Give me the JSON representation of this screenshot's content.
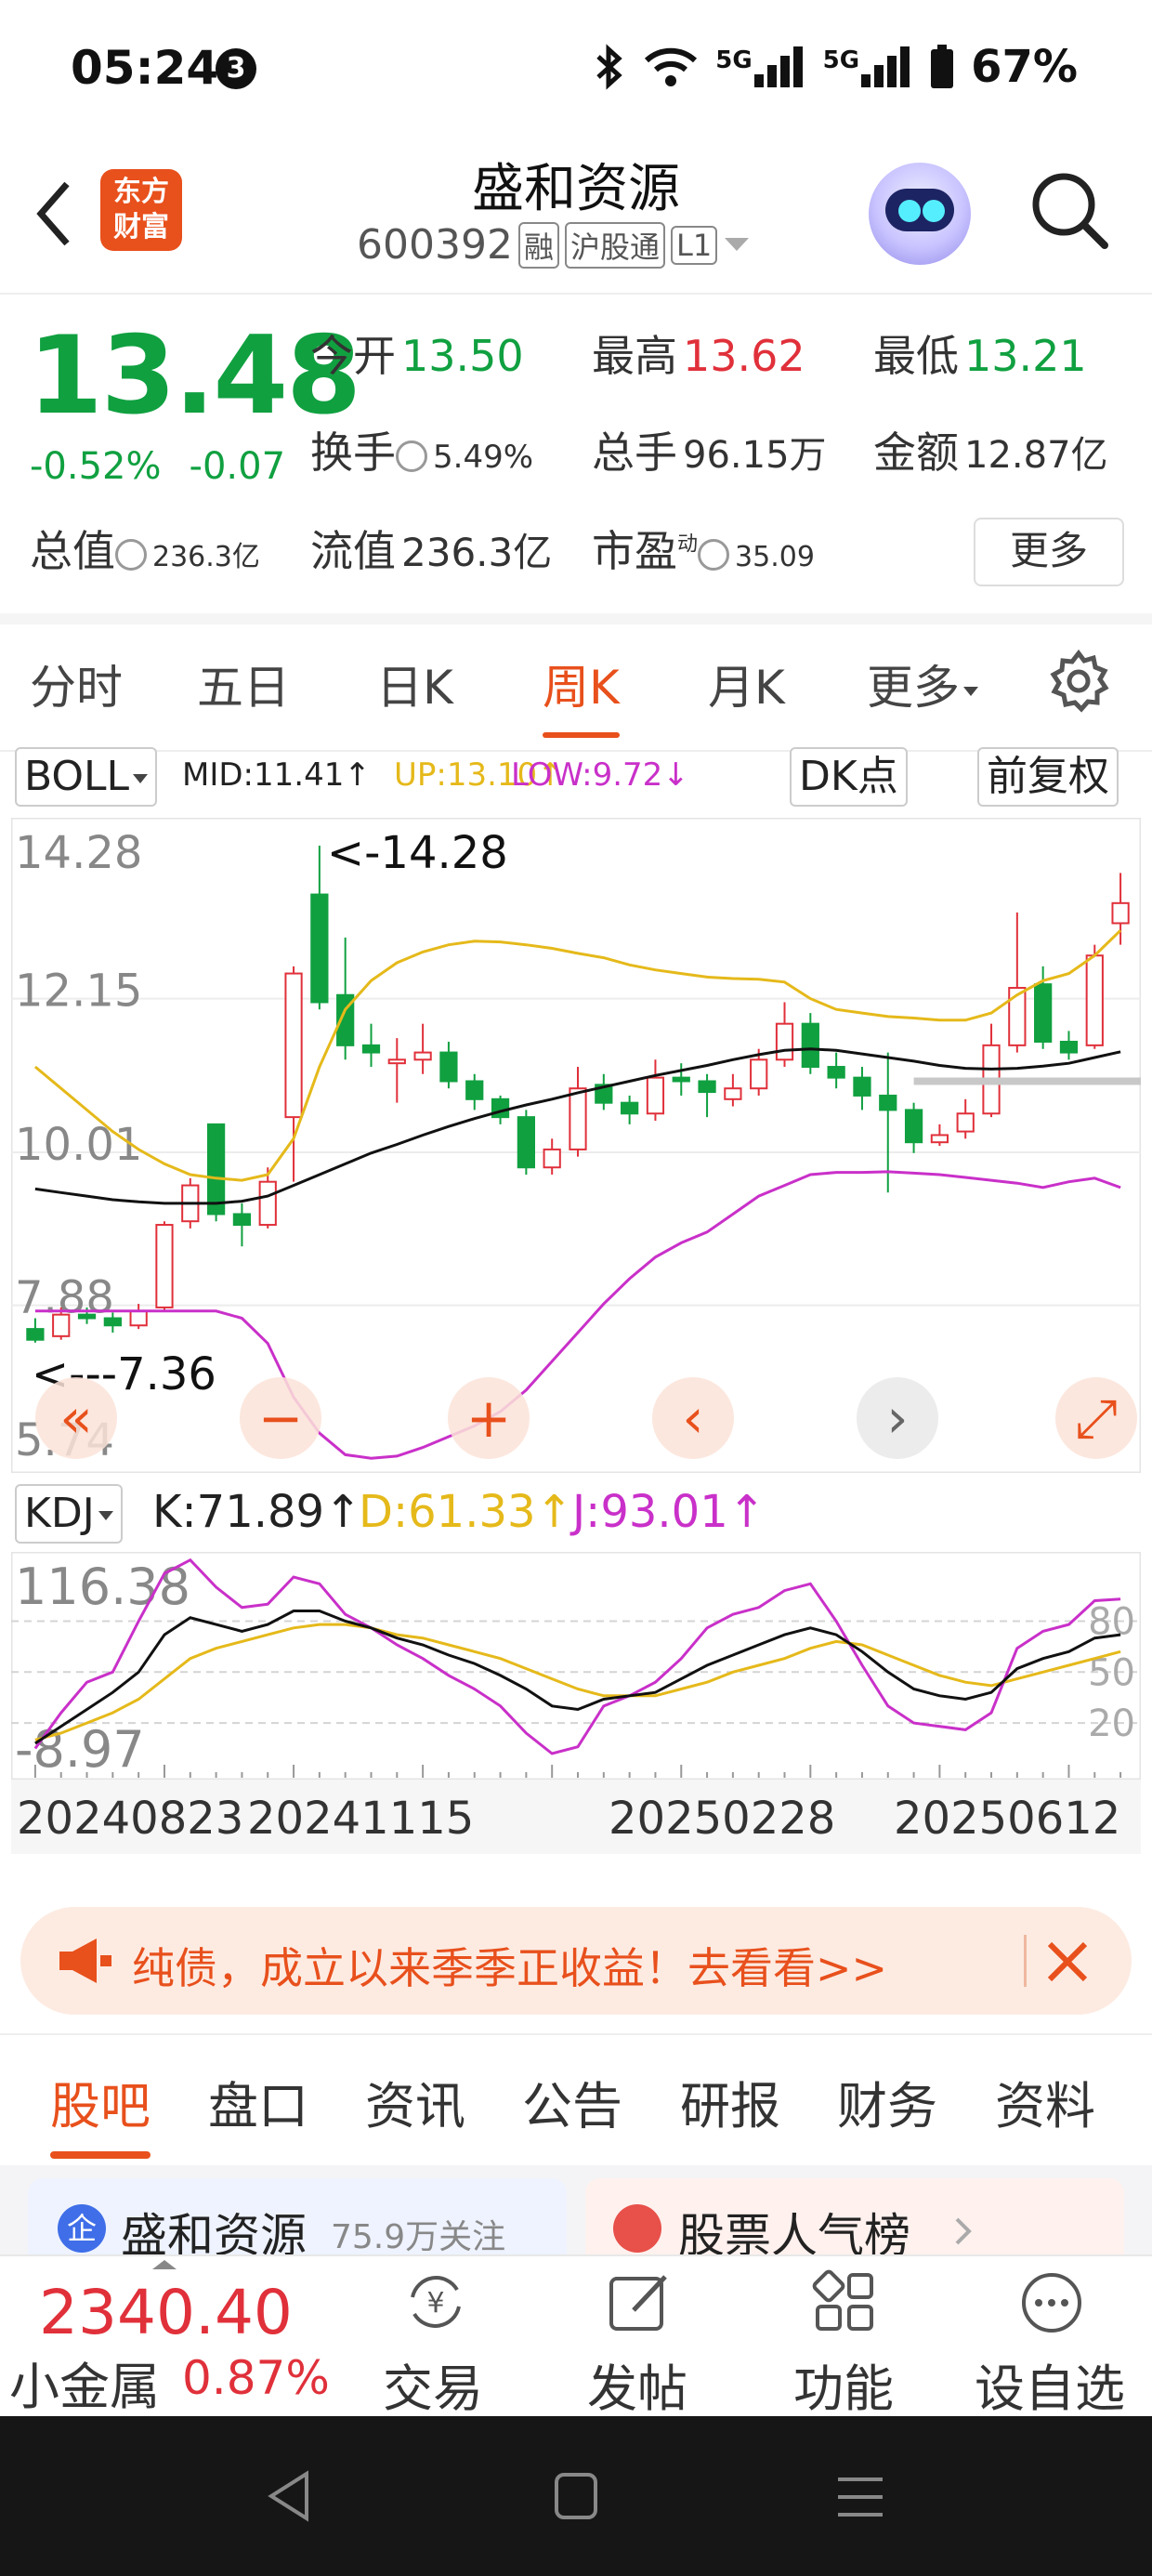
{
  "status_bar": {
    "time": "05:24",
    "badge": "3",
    "network": "5G",
    "network2": "5G",
    "battery": "67%"
  },
  "header": {
    "title": "盛和资源",
    "code": "600392",
    "tags": [
      "融",
      "沪股通",
      "L1"
    ],
    "logo_text": "东方财富"
  },
  "quote": {
    "price": "13.48",
    "change_pct": "-0.52%",
    "change": "-0.07",
    "open_label": "今开",
    "open": "13.50",
    "high_label": "最高",
    "high": "13.62",
    "low_label": "最低",
    "low": "13.21",
    "turnover_label": "换手",
    "turnover": "5.49%",
    "volume_label": "总手",
    "volume": "96.15万",
    "amount_label": "金额",
    "amount": "12.87亿",
    "mktcap_label": "总值",
    "mktcap": "236.3亿",
    "float_label": "流值",
    "float": "236.3亿",
    "pe_label": "市盈",
    "pe_sup": "动",
    "pe": "35.09",
    "more": "更多"
  },
  "tabs": [
    {
      "label": "分时"
    },
    {
      "label": "五日"
    },
    {
      "label": "日K"
    },
    {
      "label": "周K"
    },
    {
      "label": "月K"
    },
    {
      "label": "更多"
    }
  ],
  "active_tab": "周K",
  "indicator": {
    "name": "BOLL",
    "mid": "MID:11.41↑",
    "up": "UP:13.10↑",
    "low": "LOW:9.72↓",
    "dk": "DK点",
    "fq": "前复权"
  },
  "chart_data": {
    "type": "candlestick",
    "y_ticks": [
      "14.28",
      "12.15",
      "10.01",
      "7.88",
      "5.74"
    ],
    "ylim": [
      5.74,
      14.28
    ],
    "max_label": "<-14.28",
    "min_label": "<---7.36",
    "candles": [
      {
        "o": 7.55,
        "c": 7.4,
        "h": 7.7,
        "l": 7.36
      },
      {
        "o": 7.45,
        "c": 7.75,
        "h": 7.85,
        "l": 7.4
      },
      {
        "o": 7.75,
        "c": 7.7,
        "h": 7.85,
        "l": 7.62
      },
      {
        "o": 7.7,
        "c": 7.6,
        "h": 7.78,
        "l": 7.5
      },
      {
        "o": 7.6,
        "c": 7.8,
        "h": 7.9,
        "l": 7.55
      },
      {
        "o": 7.85,
        "c": 9.0,
        "h": 9.05,
        "l": 7.8
      },
      {
        "o": 9.05,
        "c": 9.55,
        "h": 9.65,
        "l": 8.95
      },
      {
        "o": 10.4,
        "c": 9.15,
        "h": 10.4,
        "l": 9.05
      },
      {
        "o": 9.15,
        "c": 9.0,
        "h": 9.3,
        "l": 8.7
      },
      {
        "o": 9.0,
        "c": 9.6,
        "h": 9.8,
        "l": 8.95
      },
      {
        "o": 10.5,
        "c": 12.5,
        "h": 12.6,
        "l": 9.6
      },
      {
        "o": 13.6,
        "c": 12.1,
        "h": 14.28,
        "l": 12.0
      },
      {
        "o": 12.2,
        "c": 11.5,
        "h": 13.0,
        "l": 11.3
      },
      {
        "o": 11.5,
        "c": 11.4,
        "h": 11.8,
        "l": 11.2
      },
      {
        "o": 11.25,
        "c": 11.3,
        "h": 11.6,
        "l": 10.7
      },
      {
        "o": 11.3,
        "c": 11.4,
        "h": 11.8,
        "l": 11.1
      },
      {
        "o": 11.4,
        "c": 11.0,
        "h": 11.55,
        "l": 10.9
      },
      {
        "o": 11.0,
        "c": 10.75,
        "h": 11.1,
        "l": 10.6
      },
      {
        "o": 10.75,
        "c": 10.5,
        "h": 10.8,
        "l": 10.4
      },
      {
        "o": 10.5,
        "c": 9.8,
        "h": 10.6,
        "l": 9.7
      },
      {
        "o": 9.8,
        "c": 10.05,
        "h": 10.2,
        "l": 9.7
      },
      {
        "o": 10.05,
        "c": 10.9,
        "h": 11.2,
        "l": 9.95
      },
      {
        "o": 10.95,
        "c": 10.7,
        "h": 11.1,
        "l": 10.6
      },
      {
        "o": 10.7,
        "c": 10.55,
        "h": 10.8,
        "l": 10.4
      },
      {
        "o": 10.55,
        "c": 11.05,
        "h": 11.3,
        "l": 10.45
      },
      {
        "o": 11.05,
        "c": 11.0,
        "h": 11.25,
        "l": 10.8
      },
      {
        "o": 11.0,
        "c": 10.85,
        "h": 11.1,
        "l": 10.5
      },
      {
        "o": 10.75,
        "c": 10.9,
        "h": 11.1,
        "l": 10.65
      },
      {
        "o": 10.9,
        "c": 11.3,
        "h": 11.45,
        "l": 10.8
      },
      {
        "o": 11.3,
        "c": 11.8,
        "h": 12.1,
        "l": 11.2
      },
      {
        "o": 11.8,
        "c": 11.2,
        "h": 11.95,
        "l": 11.1
      },
      {
        "o": 11.2,
        "c": 11.05,
        "h": 11.4,
        "l": 10.9
      },
      {
        "o": 11.05,
        "c": 10.8,
        "h": 11.2,
        "l": 10.6
      },
      {
        "o": 10.8,
        "c": 10.6,
        "h": 11.4,
        "l": 9.45
      },
      {
        "o": 10.6,
        "c": 10.15,
        "h": 10.7,
        "l": 10.0
      },
      {
        "o": 10.15,
        "c": 10.25,
        "h": 10.4,
        "l": 10.1
      },
      {
        "o": 10.3,
        "c": 10.55,
        "h": 10.75,
        "l": 10.2
      },
      {
        "o": 10.55,
        "c": 11.5,
        "h": 11.8,
        "l": 10.5
      },
      {
        "o": 11.5,
        "c": 12.3,
        "h": 13.35,
        "l": 11.4
      },
      {
        "o": 12.35,
        "c": 11.55,
        "h": 12.6,
        "l": 11.45
      },
      {
        "o": 11.55,
        "c": 11.4,
        "h": 11.7,
        "l": 11.3
      },
      {
        "o": 11.5,
        "c": 12.75,
        "h": 12.9,
        "l": 11.45
      },
      {
        "o": 13.2,
        "c": 13.48,
        "h": 13.9,
        "l": 12.9
      }
    ],
    "boll_mid": [
      9.5,
      9.45,
      9.4,
      9.35,
      9.32,
      9.3,
      9.3,
      9.3,
      9.33,
      9.4,
      9.55,
      9.7,
      9.85,
      10.0,
      10.12,
      10.25,
      10.37,
      10.48,
      10.58,
      10.67,
      10.75,
      10.84,
      10.92,
      11.0,
      11.08,
      11.15,
      11.22,
      11.3,
      11.37,
      11.43,
      11.45,
      11.43,
      11.38,
      11.33,
      11.28,
      11.22,
      11.18,
      11.17,
      11.18,
      11.21,
      11.25,
      11.33,
      11.41
    ],
    "boll_up": [
      11.2,
      10.9,
      10.6,
      10.3,
      10.05,
      9.85,
      9.7,
      9.65,
      9.62,
      9.7,
      10.2,
      11.2,
      12.0,
      12.4,
      12.65,
      12.8,
      12.9,
      12.95,
      12.94,
      12.9,
      12.85,
      12.78,
      12.72,
      12.62,
      12.55,
      12.5,
      12.45,
      12.43,
      12.42,
      12.38,
      12.15,
      12.0,
      11.95,
      11.9,
      11.88,
      11.85,
      11.85,
      11.95,
      12.2,
      12.4,
      12.5,
      12.75,
      13.1
    ],
    "boll_low": [
      7.8,
      7.8,
      7.8,
      7.8,
      7.8,
      7.8,
      7.8,
      7.8,
      7.7,
      7.35,
      6.6,
      6.1,
      5.8,
      5.75,
      5.78,
      5.9,
      6.05,
      6.2,
      6.4,
      6.7,
      7.1,
      7.5,
      7.9,
      8.25,
      8.55,
      8.75,
      8.9,
      9.15,
      9.4,
      9.55,
      9.7,
      9.73,
      9.73,
      9.74,
      9.72,
      9.7,
      9.66,
      9.62,
      9.58,
      9.52,
      9.6,
      9.65,
      9.52
    ]
  },
  "chart_controls": [
    "rewind-icon",
    "zoom-out-icon",
    "zoom-in-icon",
    "prev-icon",
    "next-icon",
    "fullscreen-icon"
  ],
  "kdj": {
    "name": "KDJ",
    "k": "K:71.89↑",
    "d": "D:61.33↑",
    "j": "J:93.01↑",
    "y_top": "116.38",
    "y_bottom": "-8.97",
    "levels": [
      "80",
      "50",
      "20"
    ],
    "ylim": [
      -8.97,
      116.38
    ],
    "K": [
      8,
      18,
      28,
      38,
      50,
      72,
      82,
      78,
      74,
      78,
      86,
      86,
      80,
      76,
      70,
      66,
      60,
      55,
      48,
      40,
      30,
      28,
      34,
      36,
      38,
      46,
      54,
      60,
      66,
      72,
      76,
      72,
      62,
      50,
      40,
      36,
      34,
      38,
      52,
      58,
      62,
      70,
      72
    ],
    "D": [
      10,
      14,
      20,
      26,
      34,
      46,
      58,
      64,
      68,
      72,
      76,
      78,
      78,
      76,
      72,
      70,
      66,
      62,
      58,
      52,
      46,
      40,
      36,
      36,
      36,
      40,
      44,
      50,
      54,
      58,
      64,
      68,
      66,
      60,
      54,
      48,
      44,
      42,
      46,
      50,
      54,
      58,
      62
    ],
    "J": [
      5,
      26,
      44,
      50,
      80,
      108,
      116,
      100,
      88,
      90,
      106,
      102,
      84,
      76,
      66,
      58,
      48,
      40,
      30,
      14,
      2,
      6,
      30,
      36,
      44,
      58,
      76,
      84,
      88,
      98,
      102,
      80,
      54,
      30,
      20,
      18,
      16,
      26,
      64,
      74,
      78,
      92,
      93
    ]
  },
  "dates": [
    "20240823",
    "20241115",
    "20250228",
    "20250612"
  ],
  "banner": {
    "text": "纯债，成立以来季季正收益！去看看>>"
  },
  "sub_tabs": [
    "股吧",
    "盘口",
    "资讯",
    "公告",
    "研报",
    "财务",
    "资料"
  ],
  "cards": {
    "left_title": "盛和资源",
    "left_sub": "75.9万关注",
    "right_title": "股票人气榜"
  },
  "bottom_bar": {
    "index_value": "2340.40",
    "index_name": "小金属",
    "index_change": "0.87%",
    "items": [
      "交易",
      "发帖",
      "功能",
      "设自选"
    ]
  },
  "colors": {
    "accent": "#e8501c",
    "up": "#e0303a",
    "down": "#10a040",
    "mid": "#111111",
    "upper": "#e5b91a",
    "lower": "#c930c9"
  }
}
